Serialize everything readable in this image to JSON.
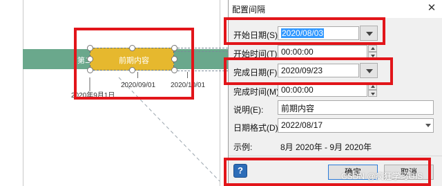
{
  "diagram": {
    "band_label": "第二季度",
    "task_label": "前期内容",
    "axis_dates": [
      "2020/09/01",
      "2020/10/01"
    ],
    "date_below": "2020年9月1日"
  },
  "dialog": {
    "title": "配置间隔",
    "close_label": "✕",
    "start_date": {
      "label": "开始日期(S):",
      "value": "2020/08/03"
    },
    "start_time": {
      "label": "开始时间(T):",
      "value": "00:00:00"
    },
    "finish_date": {
      "label": "完成日期(F):",
      "value": "2020/09/23"
    },
    "finish_time": {
      "label": "完成时间(M):",
      "value": "00:00:00"
    },
    "description": {
      "label": "说明(E):",
      "value": "前期内容"
    },
    "date_format": {
      "label": "日期格式(D):",
      "value": "2022/08/17"
    },
    "example": {
      "label": "示例:",
      "value": "8月 2020年 - 9月 2020年"
    },
    "help_label": "?",
    "ok_label": "确定",
    "cancel_label": "取消"
  },
  "watermark": "CSDN @疯狂学习GIS",
  "colors": {
    "highlight_red": "#e2151a",
    "task_gold": "#e6b82e",
    "band_teal": "#6aa88c",
    "selection_blue": "#3399ff"
  }
}
